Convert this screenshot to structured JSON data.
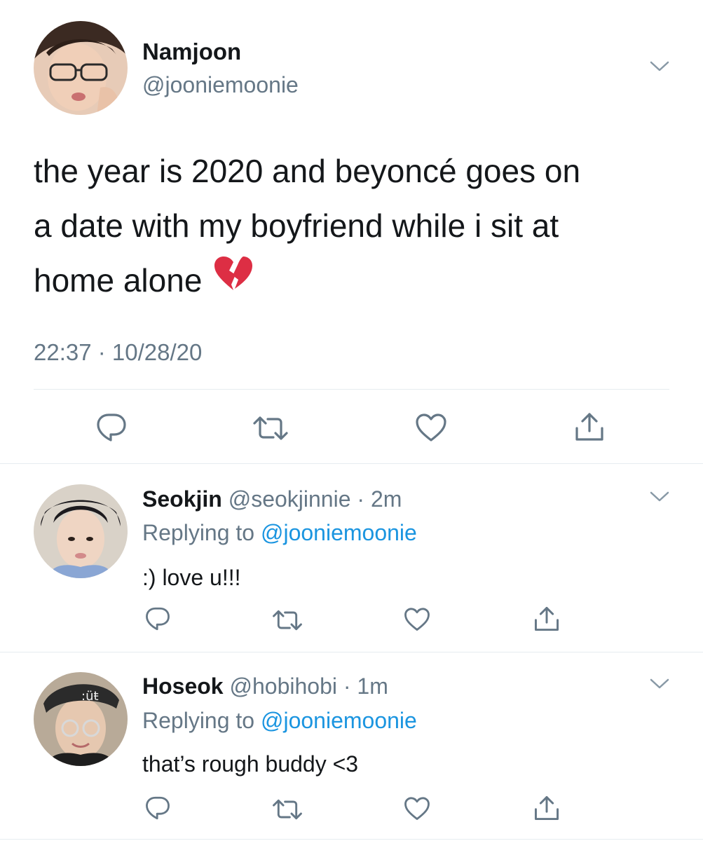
{
  "main_tweet": {
    "display_name": "Namjoon",
    "handle": "@jooniemoonie",
    "text_lines": [
      "the year is 2020 and beyoncé goes on",
      "a date with my boyfriend while i sit at",
      "home alone"
    ],
    "emoji": "broken-heart",
    "timestamp": "22:37 · 10/28/20"
  },
  "replies": [
    {
      "display_name": "Seokjin",
      "handle": "@seokjinnie",
      "age": "2m",
      "replying_label": "Replying to",
      "replying_to": "@jooniemoonie",
      "text": ":) love u!!!"
    },
    {
      "display_name": "Hoseok",
      "handle": "@hobihobi",
      "age": "1m",
      "replying_label": "Replying to",
      "replying_to": "@jooniemoonie",
      "text": "that’s rough buddy <3"
    }
  ],
  "icons": [
    "reply-icon",
    "retweet-icon",
    "like-icon",
    "share-icon",
    "chevron-down-icon"
  ],
  "colors": {
    "text": "#14171a",
    "muted": "#657786",
    "link": "#1b95e0",
    "divider": "#e6ecf0"
  }
}
